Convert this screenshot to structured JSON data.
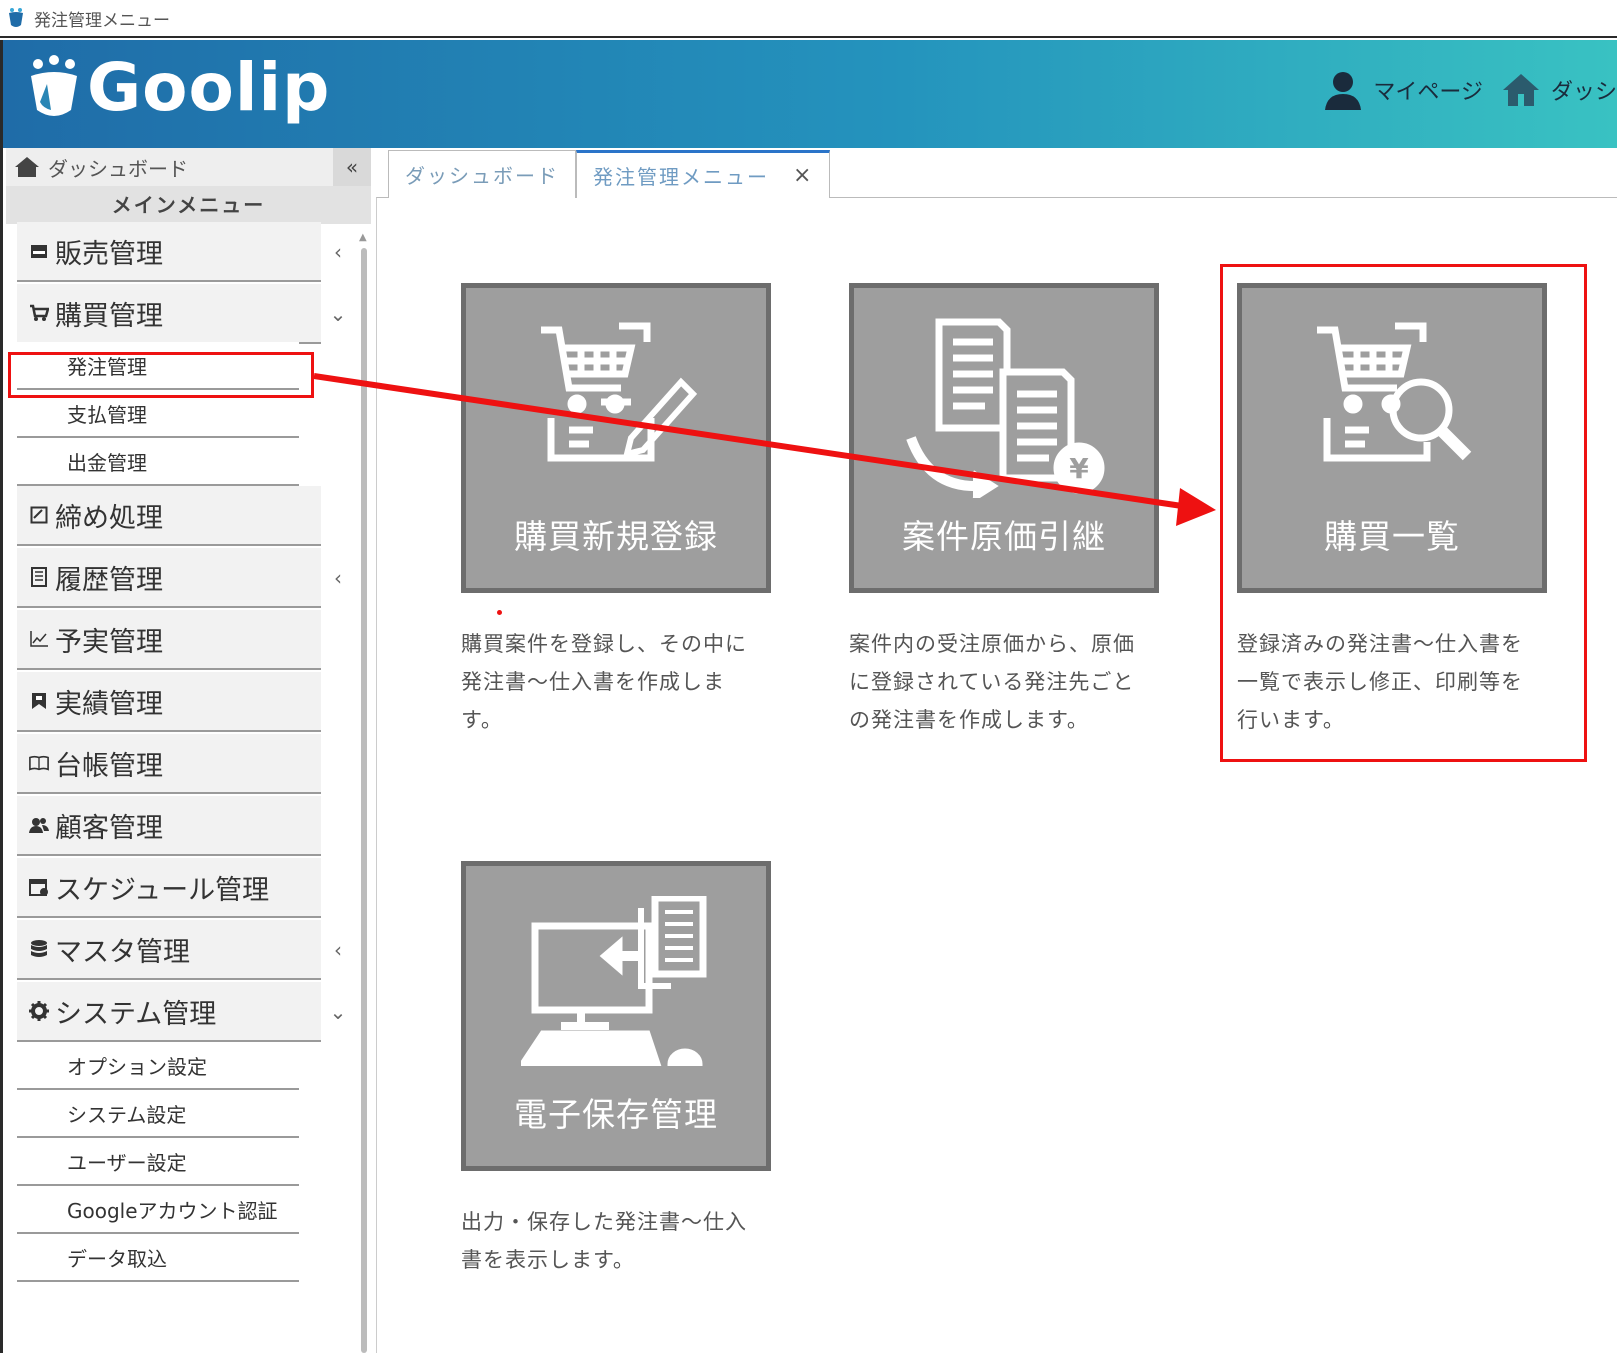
{
  "window": {
    "title": "発注管理メニュー"
  },
  "header": {
    "brand": "Goolip",
    "links": [
      {
        "label": "マイページ",
        "icon": "user-icon"
      },
      {
        "label": "ダッシ",
        "icon": "home-icon"
      }
    ]
  },
  "sidebar": {
    "dashboard_label": "ダッシュボード",
    "collapse_label": "«",
    "main_menu_label": "メインメニュー",
    "items": [
      {
        "label": "販売管理",
        "icon": "store-icon",
        "caret": "‹"
      },
      {
        "label": "購買管理",
        "icon": "cart-icon",
        "caret": "⌄"
      },
      {
        "label": "締め処理",
        "icon": "checkbox-icon",
        "caret": ""
      },
      {
        "label": "履歴管理",
        "icon": "history-icon",
        "caret": "‹"
      },
      {
        "label": "予実管理",
        "icon": "line-chart-icon",
        "caret": ""
      },
      {
        "label": "実績管理",
        "icon": "bookmark-icon",
        "caret": ""
      },
      {
        "label": "台帳管理",
        "icon": "book-icon",
        "caret": ""
      },
      {
        "label": "顧客管理",
        "icon": "users-icon",
        "caret": ""
      },
      {
        "label": "スケジュール管理",
        "icon": "calendar-icon",
        "caret": ""
      },
      {
        "label": "マスタ管理",
        "icon": "database-icon",
        "caret": "‹"
      },
      {
        "label": "システム管理",
        "icon": "gear-icon",
        "caret": "⌄"
      }
    ],
    "purchase_sub": [
      "発注管理",
      "支払管理",
      "出金管理"
    ],
    "system_sub": [
      "オプション設定",
      "システム設定",
      "ユーザー設定",
      "Googleアカウント認証",
      "データ取込"
    ]
  },
  "tabs": [
    {
      "label": "ダッシュボード",
      "active": false
    },
    {
      "label": "発注管理メニュー",
      "active": true,
      "close": "×"
    }
  ],
  "tiles": [
    {
      "label": "購買新規登録",
      "icon": "cart-edit-icon",
      "desc": [
        "購買案件を登録し、その中に",
        "発注書～仕入書を作成しま",
        "す。"
      ]
    },
    {
      "label": "案件原価引継",
      "icon": "documents-yen-icon",
      "desc": [
        "案件内の受注原価から、原価",
        "に登録されている発注先ごと",
        "の発注書を作成します。"
      ]
    },
    {
      "label": "購買一覧",
      "icon": "cart-search-icon",
      "desc": [
        "登録済みの発注書～仕入書を",
        "一覧で表示し修正、印刷等を",
        "行います。"
      ]
    },
    {
      "label": "電子保存管理",
      "icon": "computer-import-icon",
      "desc": [
        "出力・保存した発注書～仕入",
        "書を表示します。"
      ]
    }
  ],
  "colors": {
    "annotation": "#ee1111",
    "tile_bg": "#9e9e9e",
    "tile_border": "#6d6d6d",
    "accent": "#2a74c9"
  }
}
